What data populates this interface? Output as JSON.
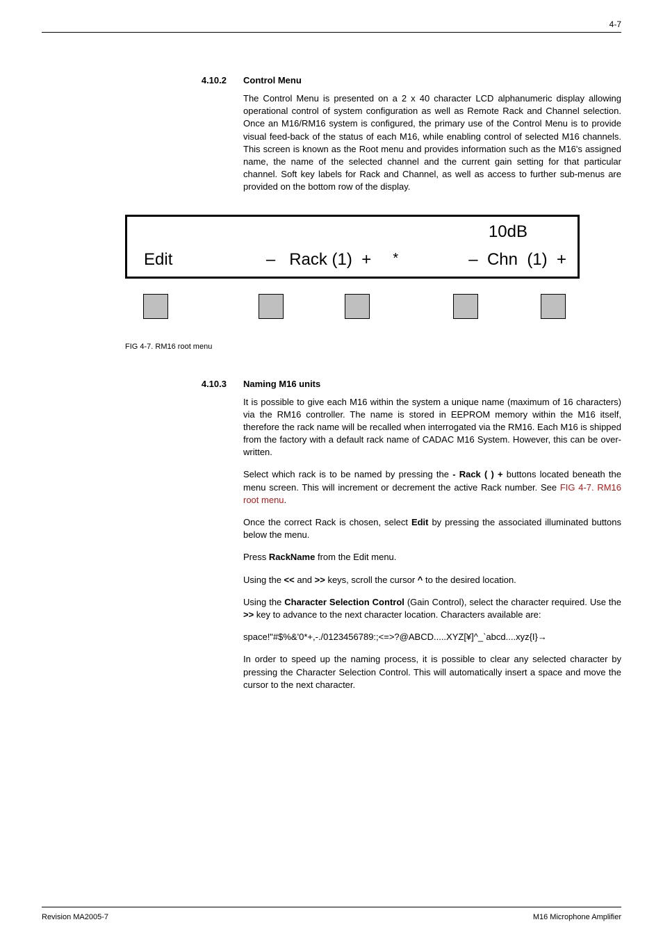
{
  "page_number": "4-7",
  "sections": {
    "s1": {
      "num": "4.10.2",
      "title": "Control Menu",
      "p1": "The Control Menu is presented on a 2 x 40 character LCD alphanumeric display allowing operational control of system configuration as well as Remote Rack and Channel selection. Once an M16/RM16 system  is configured, the primary use of the Control Menu is to provide visual feed-back of the status of each M16, while enabling control of selected M16 channels. This screen is known as the Root menu and provides information such as the M16's assigned name, the name of the selected channel and the current gain setting for that particular channel. Soft key labels for Rack and Channel, as well as access to further sub-menus are provided on the bottom row of the display."
    },
    "s2": {
      "num": "4.10.3",
      "title": "Naming M16 units",
      "p1": "It is possible to give each M16 within the system a unique name (maximum of 16 characters) via the RM16 controller. The name is stored in EEPROM memory within the M16 itself, therefore the rack name will be recalled when interrogated via the RM16. Each M16 is shipped from the factory with a default rack name of CADAC M16 System. However, this can be over-written.",
      "p2a": "Select which rack is to be named by pressing the ",
      "p2b": "- Rack ( ) +",
      "p2c": " buttons located beneath the menu screen. This will increment or decrement the active Rack number. See ",
      "p2d": "FIG 4-7. RM16 root menu",
      "p2e": ".",
      "p3a": "Once the correct Rack is chosen, select ",
      "p3b": "Edit",
      "p3c": " by pressing the associated illuminated buttons below the menu.",
      "p4a": "Press ",
      "p4b": "RackName",
      "p4c": " from the Edit menu.",
      "p5a": "Using the ",
      "p5b": "<<",
      "p5c": " and ",
      "p5d": ">>",
      "p5e": " keys, scroll the cursor ",
      "p5f": "^",
      "p5g": " to the desired location.",
      "p6a": "Using the ",
      "p6b": "Character Selection Control",
      "p6c": " (Gain Control), select the character required.  Use the ",
      "p6d": ">>",
      "p6e": " key to advance to the next character location. Characters available are:",
      "p7": "space!\"#$%&'0*+,-./0123456789:;<=>?@ABCD.....XYZ[¥]^_`abcd....xyz{I}→",
      "p8": "In order to speed up the naming process, it is possible to clear any selected character by pressing the Character Selection Control. This will automatically insert a space and move the cursor to the next character."
    }
  },
  "figure": {
    "caption": "FIG 4-7.  RM16 root menu",
    "lcd": {
      "gain": "10dB",
      "edit": "Edit",
      "rack": "–   Rack (1)  +",
      "star": "*",
      "chn": "–  Chn  (1)  +"
    }
  },
  "footer": {
    "left": "Revision MA2005-7",
    "right": "M16 Microphone Amplifier"
  }
}
